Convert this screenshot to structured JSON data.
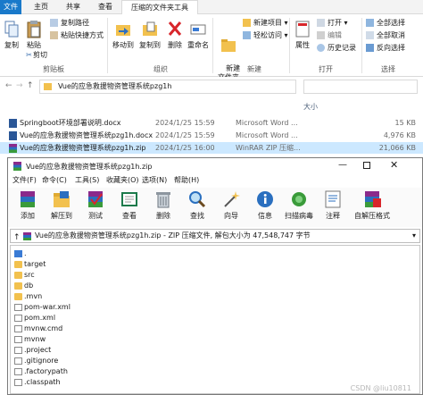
{
  "ribbon_tabs": [
    "文件",
    "主页",
    "共享",
    "查看",
    "压缩的文件夹工具"
  ],
  "ribbon": {
    "copy": "复制",
    "paste": "粘贴",
    "copy_path": "复制路径",
    "paste_shortcut": "粘贴快捷方式",
    "cut": "剪切",
    "group_clipboard": "剪贴板",
    "move_to": "移动到",
    "copy_to": "复制到",
    "delete": "删除",
    "rename": "重命名",
    "group_organize": "组织",
    "new_folder": "新建\n文件夹",
    "new_item": "新建项目 ▾",
    "easy_access": "轻松访问 ▾",
    "group_new": "新建",
    "properties": "属性",
    "open": "打开 ▾",
    "edit": "编辑",
    "history": "历史记录",
    "group_open": "打开",
    "select_all": "全部选择",
    "select_none": "全部取消",
    "invert_selection": "反向选择",
    "group_select": "选择"
  },
  "address": {
    "path": "Vue的应急救援物资管理系统pzg1h"
  },
  "list_header": {
    "size": "大小"
  },
  "files": [
    {
      "name": "Springboot环境部署说明.docx",
      "date": "2024/1/25 15:59",
      "type": "Microsoft Word ...",
      "size": "15 KB"
    },
    {
      "name": "Vue的应急救援物资管理系统pzg1h.docx",
      "date": "2024/1/25 15:59",
      "type": "Microsoft Word ...",
      "size": "4,976 KB"
    },
    {
      "name": "Vue的应急救援物资管理系统pzg1h.zip",
      "date": "2024/1/25 16:00",
      "type": "WinRAR ZIP 压缩...",
      "size": "21,066 KB"
    }
  ],
  "rar": {
    "title": "Vue的应急救援物资管理系统pzg1h.zip",
    "menu": [
      "文件(F)",
      "命令(C)",
      "工具(S)",
      "收藏夹(O)",
      "选项(N)",
      "帮助(H)"
    ],
    "tools": [
      "添加",
      "解压到",
      "测试",
      "查看",
      "删除",
      "查找",
      "向导",
      "信息",
      "扫描病毒",
      "注释",
      "自解压格式"
    ],
    "path": "Vue的应急救援物资管理系统pzg1h.zip - ZIP 压缩文件, 解包大小为 47,548,747 字节",
    "items": [
      ".",
      "target",
      "src",
      "db",
      ".mvn",
      "pom-war.xml",
      "pom.xml",
      "mvnw.cmd",
      "mvnw",
      ".project",
      ".gitignore",
      ".factorypath",
      ".classpath"
    ]
  },
  "watermark": "CSDN @liu10811"
}
